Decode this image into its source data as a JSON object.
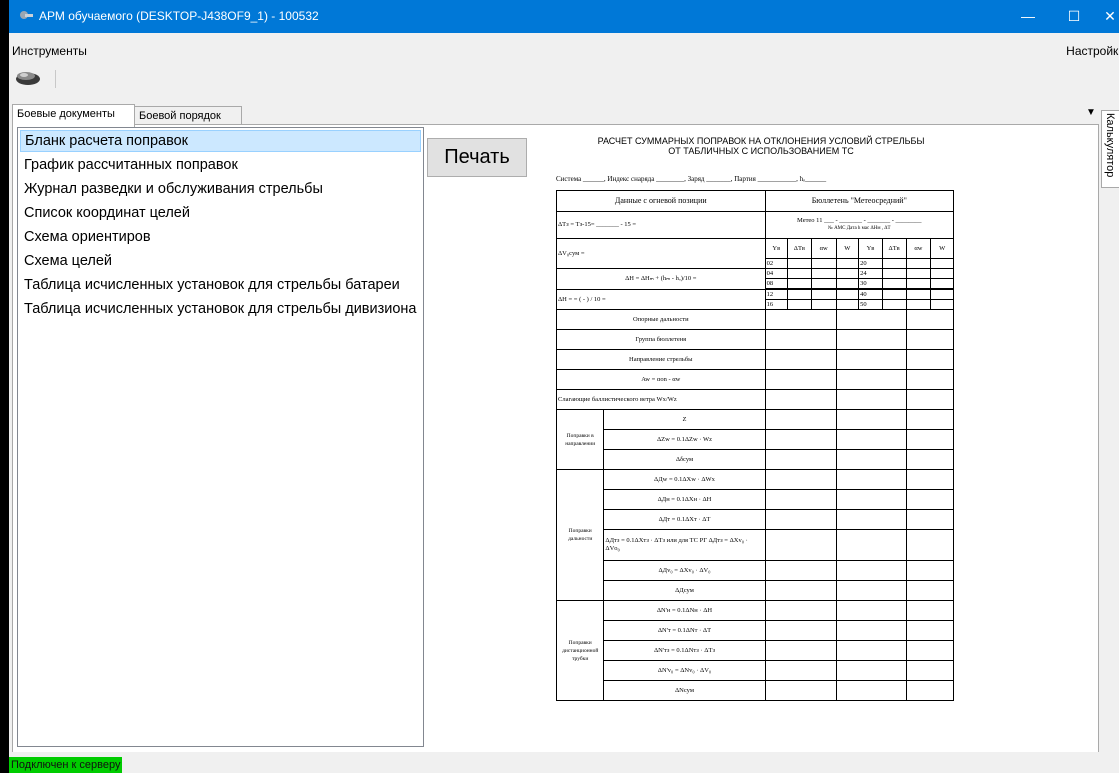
{
  "window": {
    "title": "АРМ обучаемого (DESKTOP-J438OF9_1) - 100532",
    "minimize": "—",
    "maximize": "☐",
    "close": "✕"
  },
  "menu": {
    "tools": "Инструменты",
    "settings": "Настройки"
  },
  "toolbar": {
    "icon": "printer-icon"
  },
  "tabs": [
    {
      "label": "Боевые документы",
      "active": true
    },
    {
      "label": "Боевой порядок",
      "active": false
    }
  ],
  "side_tab": {
    "label": "Калькулятор"
  },
  "collapse_icon": "▼",
  "documents": [
    {
      "label": "Бланк расчета поправок",
      "selected": true
    },
    {
      "label": "График рассчитанных поправок",
      "selected": false
    },
    {
      "label": "Журнал разведки и обслуживания стрельбы",
      "selected": false
    },
    {
      "label": "Список координат целей",
      "selected": false
    },
    {
      "label": "Схема ориентиров",
      "selected": false
    },
    {
      "label": "Схема целей",
      "selected": false
    },
    {
      "label": "Таблица исчисленных установок для стрельбы батареи",
      "selected": false
    },
    {
      "label": "Таблица исчисленных установок для стрельбы дивизиона",
      "selected": false
    }
  ],
  "print_button": "Печать",
  "form": {
    "title_line1": "РАСЧЕТ СУММАРНЫХ ПОПРАВОК НА ОТКЛОНЕНИЯ  УСЛОВИЙ СТРЕЛЬБЫ",
    "title_line2": "ОТ  ТАБЛИЧНЫХ  С  ИСПОЛЬЗОВАНИЕМ ТС",
    "params_line": "Система ______, Индекс снаряда ________, Заряд _______, Партия ___________, hₒ______",
    "fire_position_header": "Данные с огневой позиции",
    "bulletin_header": "Бюллетень \"Метеосредний\"",
    "dT_formula": "ΔTз = Tз-15= _______ - 15 =",
    "meteo_line": "Метео 11 ___ - _______ - _______ - ________",
    "meteo_sub": "№ АМС     Дата       h мас      ΔHм  , ΔT",
    "dV_label": "ΔV₀сум =",
    "dH_formula": "ΔH = ΔHₘ + (hₘ - hₒ)/10 =",
    "dH_calc": "ΔH =      = (      -       ) / 10 =",
    "bulletin_cols": [
      "Yв",
      "ΔTв",
      "αw",
      "W",
      "Yв",
      "ΔTв",
      "αw",
      "W"
    ],
    "heights_left": [
      "02",
      "04",
      "08",
      "12",
      "16"
    ],
    "heights_right": [
      "20",
      "24",
      "30",
      "40",
      "50"
    ],
    "rows_mid": [
      "Опорные дальности",
      "Группа бюллетеня",
      "Направление стрельбы",
      "Aw = αon - αw",
      "Слагающие баллистического ветра Wx/Wz"
    ],
    "dir_label": "Поправки в направлении",
    "dir_rows": [
      "Z",
      "ΔZw = 0.1ΔZw · Wz",
      "Δδсум"
    ],
    "range_label": "Поправки дальности",
    "range_rows": [
      "ΔДw = 0.1ΔXw · ΔWx",
      "ΔДн = 0.1ΔXн · ΔH",
      "ΔДт = 0.1ΔXт · ΔT",
      "ΔДтз = 0.1ΔXтз · ΔTз или для ТС РГ ΔДтз = ΔXv₀ · ΔVо₀",
      "ΔДv₀ = ΔXv₀ · ΔV₀",
      "ΔДсум"
    ],
    "fuse_label": "Поправки дистанционной трубки",
    "fuse_rows": [
      "ΔN'н = 0.1ΔNн · ΔH",
      "ΔN'т = 0.1ΔNт · ΔT",
      "ΔN'тз = 0.1ΔNтз · ΔTз",
      "ΔN'v₀ = ΔNv₀ · ΔV₀",
      "ΔNсум"
    ]
  },
  "status": "Подключен к серверу",
  "colors": {
    "titlebar": "#0078d7",
    "selected_item": "#cce8ff",
    "status_ok": "#00cc00"
  }
}
